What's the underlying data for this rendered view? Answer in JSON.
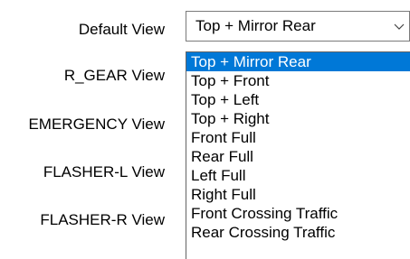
{
  "labels": [
    "Default View",
    "R_GEAR View",
    "EMERGENCY View",
    "FLASHER-L View",
    "FLASHER-R View"
  ],
  "combo": {
    "value": "Top + Mirror Rear",
    "chevron_icon": "chevron-down-icon"
  },
  "dropdown": {
    "selected_index": 0,
    "options": [
      "Top + Mirror Rear",
      "Top + Front",
      "Top + Left",
      "Top + Right",
      "Front Full",
      "Rear Full",
      "Left Full",
      "Right Full",
      "Front Crossing Traffic",
      "Rear Crossing Traffic"
    ]
  },
  "colors": {
    "selection": "#0078d7",
    "border": "#7a7a7a"
  }
}
